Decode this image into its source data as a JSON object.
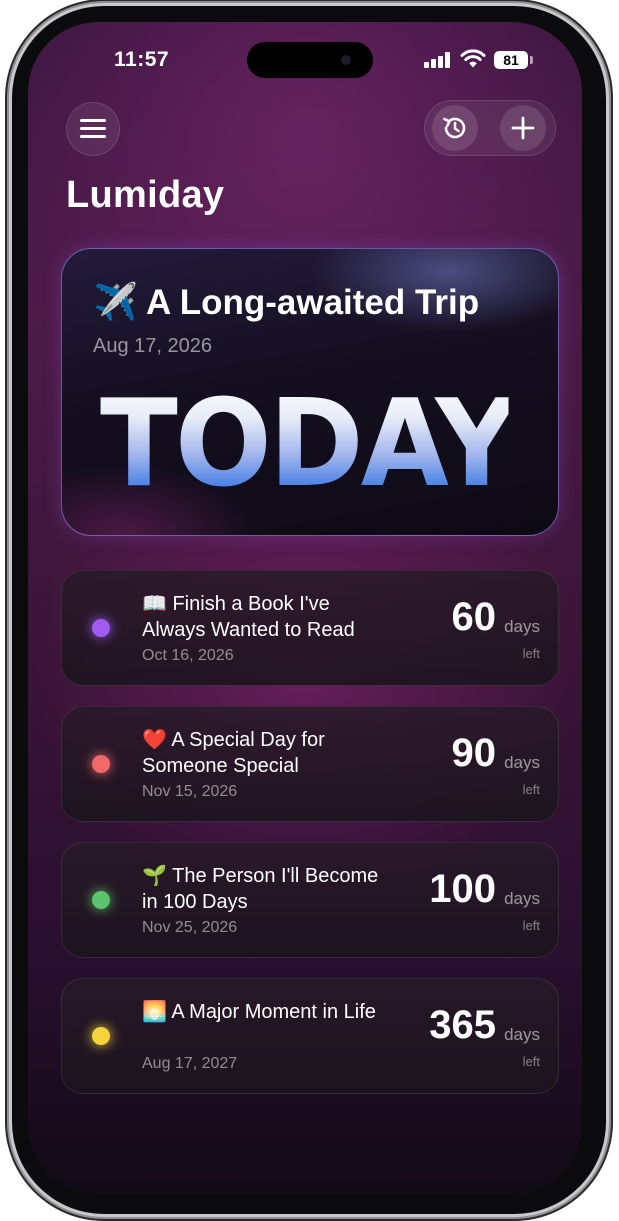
{
  "status_bar": {
    "time": "11:57",
    "battery": "81"
  },
  "header": {
    "app_title": "Lumiday"
  },
  "hero": {
    "emoji": "✈️",
    "title": "A Long-awaited Trip",
    "date": "Aug 17, 2026",
    "countdown_label": "TODAY",
    "accent_color": "#4f86e6"
  },
  "events": [
    {
      "emoji": "📖",
      "title": "Finish a Book I've Always Wanted to Read",
      "date": "Oct 16, 2026",
      "count": "60",
      "unit": "days",
      "suffix": "left",
      "color": "#a05cf0"
    },
    {
      "emoji": "❤️",
      "title": "A Special Day for Someone Special",
      "date": "Nov 15, 2026",
      "count": "90",
      "unit": "days",
      "suffix": "left",
      "color": "#f06a6a"
    },
    {
      "emoji": "🌱",
      "title": "The Person I'll Become in 100 Days",
      "date": "Nov 25, 2026",
      "count": "100",
      "unit": "days",
      "suffix": "left",
      "color": "#5cc46a"
    },
    {
      "emoji": "🌅",
      "title": "A Major Moment in Life",
      "date": "Aug 17, 2027",
      "count": "365",
      "unit": "days",
      "suffix": "left",
      "color": "#f5d33c"
    }
  ]
}
